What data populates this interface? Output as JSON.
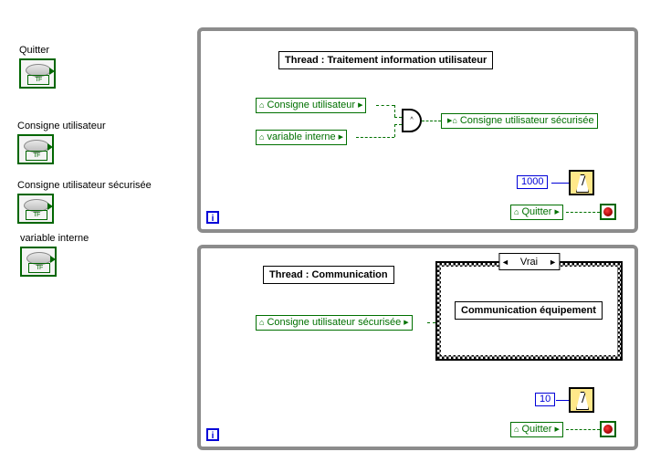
{
  "controls": {
    "quitter": "Quitter",
    "consigne": "Consigne utilisateur",
    "consigne_sec": "Consigne utilisateur sécurisée",
    "var_interne": "variable interne"
  },
  "loop1": {
    "title": "Thread : Traitement information utilisateur",
    "var1": "Consigne utilisateur",
    "var2": "variable interne",
    "var3": "Consigne utilisateur sécurisée",
    "delay": "1000",
    "quitter": "Quitter",
    "iteration": "i",
    "gate": "^"
  },
  "loop2": {
    "title": "Thread : Communication",
    "var1": "Consigne utilisateur sécurisée",
    "case_label": "Vrai",
    "case_content": "Communication équipement",
    "delay": "10",
    "quitter": "Quitter",
    "iteration": "i"
  },
  "bool_tf": "TF"
}
